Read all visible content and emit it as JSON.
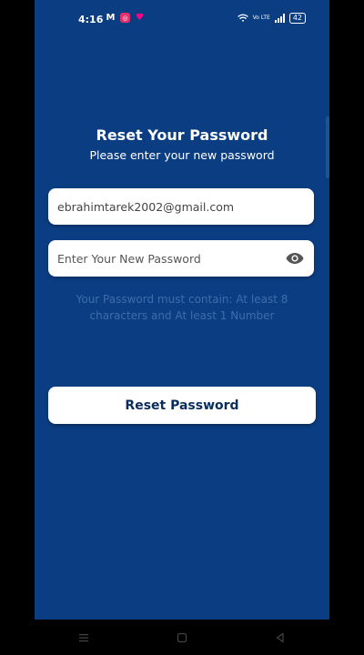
{
  "status_bar": {
    "time": "4:16",
    "battery": "42",
    "lte_label": "Vo LTE"
  },
  "page": {
    "title": "Reset Your Password",
    "subtitle": "Please enter your new password"
  },
  "email_field": {
    "value": "ebrahimtarek2002@gmail.com"
  },
  "password_field": {
    "placeholder": "Enter Your New Password",
    "value": ""
  },
  "hint": {
    "text": "Your Password must contain: At least 8 characters and At least 1 Number"
  },
  "reset_button": {
    "label": "Reset Password"
  },
  "colors": {
    "background": "#0b3d82",
    "button_text": "#0b2d5c",
    "hint_text": "#3f6cab"
  },
  "icons": {
    "eye": "eye-icon",
    "nav_recents": "menu-icon",
    "nav_home": "square-icon",
    "nav_back": "back-icon"
  }
}
